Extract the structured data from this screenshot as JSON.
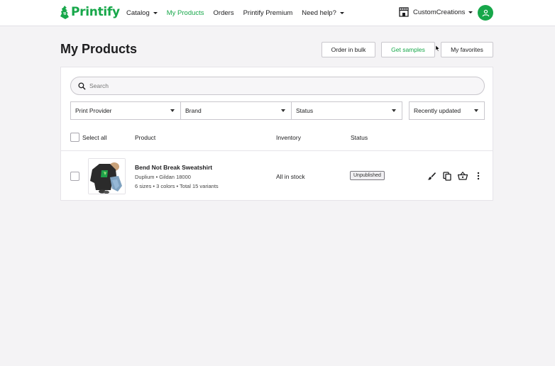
{
  "brand": {
    "name": "Printify",
    "accent": "#17a74a"
  },
  "nav": [
    {
      "label": "Catalog",
      "dropdown": true,
      "active": false
    },
    {
      "label": "My Products",
      "dropdown": false,
      "active": true
    },
    {
      "label": "Orders",
      "dropdown": false,
      "active": false
    },
    {
      "label": "Printify Premium",
      "dropdown": false,
      "active": false
    },
    {
      "label": "Need help?",
      "dropdown": true,
      "active": false
    }
  ],
  "store": {
    "name": "CustomCreations",
    "icon": "store-icon"
  },
  "user": {
    "icon": "user-icon"
  },
  "page": {
    "title": "My Products"
  },
  "actions": {
    "bulk": "Order in bulk",
    "samples": "Get samples",
    "favorites": "My favorites"
  },
  "search": {
    "placeholder": "Search"
  },
  "filters": {
    "provider": "Print Provider",
    "brand": "Brand",
    "status": "Status",
    "sort": "Recently updated"
  },
  "table": {
    "select_all": "Select all",
    "columns": {
      "product": "Product",
      "inventory": "Inventory",
      "status": "Status"
    },
    "rows": [
      {
        "name": "Bend Not Break Sweatshirt",
        "provider": "Duplium • Gildan 18000",
        "variants": "6 sizes • 3 colors • Total 15 variants",
        "inventory": "All in stock",
        "status": "Unpublished"
      }
    ]
  }
}
